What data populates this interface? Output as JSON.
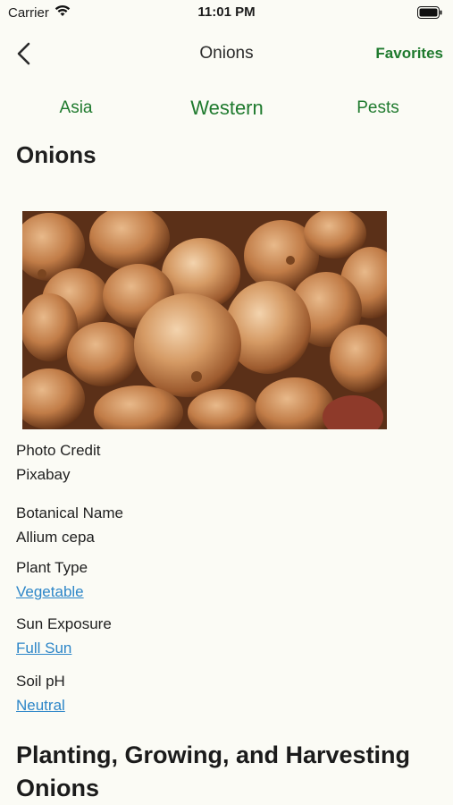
{
  "status": {
    "carrier": "Carrier",
    "time": "11:01 PM"
  },
  "nav": {
    "title": "Onions",
    "favorites_label": "Favorites"
  },
  "tabs": [
    {
      "label": "Asia"
    },
    {
      "label": "Western"
    },
    {
      "label": "Pests"
    }
  ],
  "page_title": "Onions",
  "details": {
    "photo_credit_label": "Photo Credit",
    "photo_credit_value": "Pixabay",
    "botanical_name_label": "Botanical Name",
    "botanical_name_value": "Allium cepa",
    "plant_type_label": "Plant Type",
    "plant_type_value": "Vegetable",
    "sun_exposure_label": "Sun Exposure",
    "sun_exposure_value": "Full Sun",
    "soil_ph_label": "Soil pH",
    "soil_ph_value": "Neutral"
  },
  "section": {
    "title": "Planting, Growing, and Harvesting Onions"
  },
  "colors": {
    "accent_green": "#1f7a2e",
    "link_blue": "#2d86c8",
    "background": "#fbfbf5"
  },
  "icons": {
    "back": "chevron-left-icon",
    "wifi": "wifi-icon",
    "battery": "battery-icon"
  }
}
